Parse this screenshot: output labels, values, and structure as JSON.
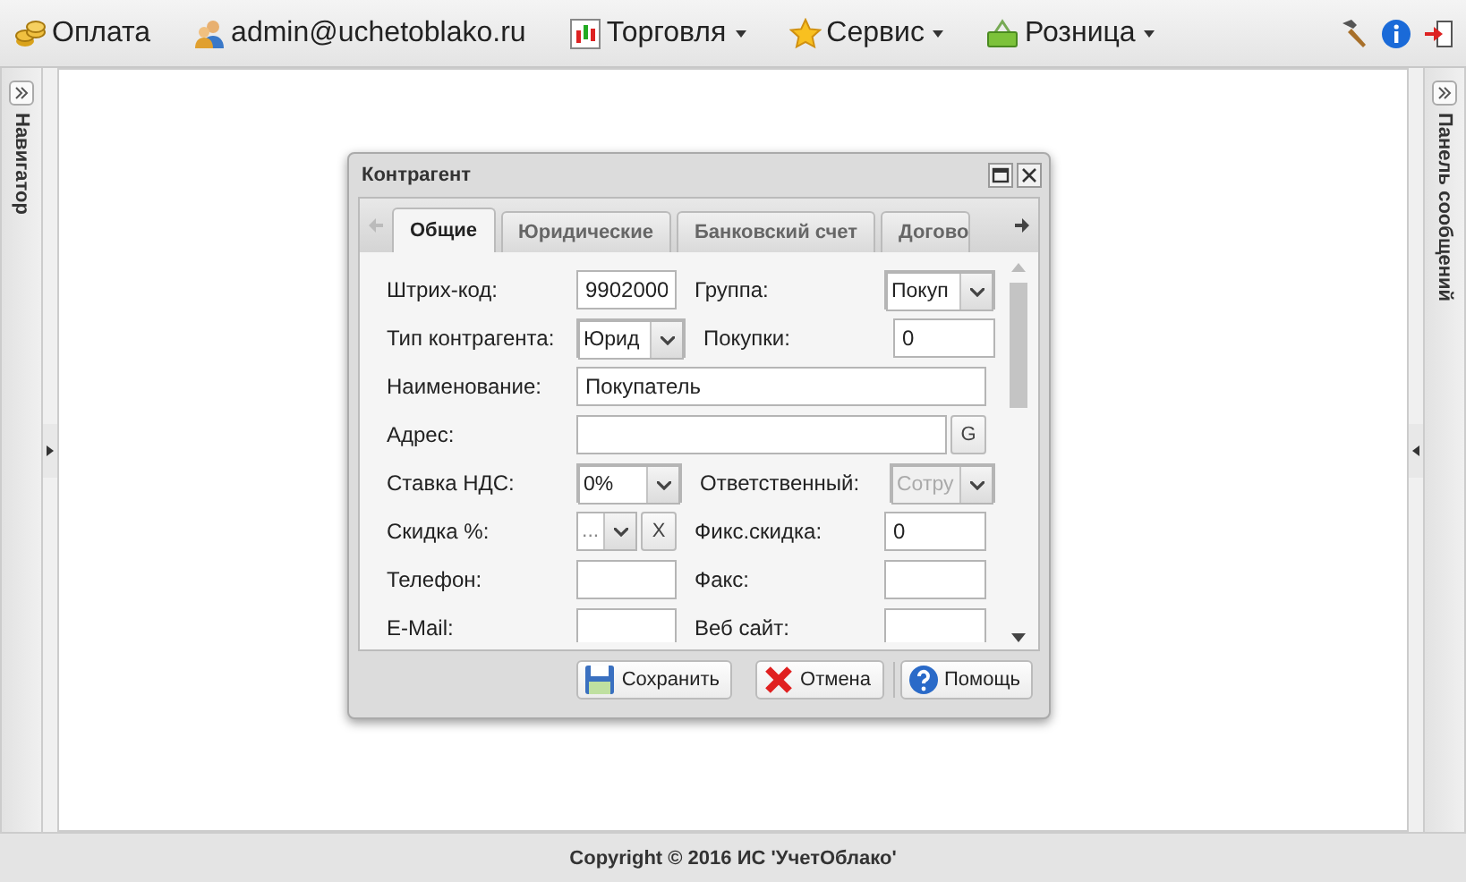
{
  "menu": [
    {
      "kind": "coins",
      "label": "Оплата",
      "dropdown": false
    },
    {
      "kind": "users",
      "label": "admin@uchetoblako.ru",
      "dropdown": false
    },
    {
      "kind": "chart",
      "label": "Торговля",
      "dropdown": true
    },
    {
      "kind": "star",
      "label": "Сервис",
      "dropdown": true
    },
    {
      "kind": "basket",
      "label": "Розница",
      "dropdown": true
    }
  ],
  "left_panel": {
    "title": "Навигатор"
  },
  "right_panel": {
    "title": "Панель сообщений"
  },
  "dialog": {
    "title": "Контрагент",
    "tabs": [
      {
        "label": "Общие",
        "selected": true
      },
      {
        "label": "Юридические",
        "selected": false
      },
      {
        "label": "Банковский счет",
        "selected": false
      },
      {
        "label": "Догово",
        "selected": false
      }
    ],
    "rows": [
      {
        "fields": [
          {
            "label": "Штрих-код:",
            "kind": "text",
            "value": "9902000",
            "disabled": false
          },
          {
            "label": "Группа:",
            "kind": "combo",
            "value": "Покуп",
            "disabled": false
          }
        ]
      },
      {
        "fields": [
          {
            "label": "Тип контрагента:",
            "kind": "combo",
            "value": "Юрид",
            "disabled": false
          },
          {
            "label": "Покупки:",
            "kind": "text",
            "value": "0",
            "disabled": false
          }
        ]
      },
      {
        "fields": [
          {
            "label": "Наименование:",
            "kind": "wide",
            "value": "Покупатель",
            "disabled": false
          }
        ]
      },
      {
        "fields": [
          {
            "label": "Адрес:",
            "kind": "wide-button",
            "button": "G",
            "disabled": false
          }
        ]
      },
      {
        "fields": [
          {
            "label": "Ставка НДС:",
            "kind": "combo",
            "value": "0%",
            "disabled": false
          },
          {
            "label": "Ответственный:",
            "kind": "combo",
            "value": "Сотру",
            "disabled": true
          }
        ]
      },
      {
        "fields": [
          {
            "label": "Скидка %:",
            "kind": "combo-clear",
            "placeholder": "...",
            "button": "X",
            "disabled": false
          },
          {
            "label": "Фикс.скидка:",
            "kind": "text",
            "value": "0",
            "disabled": false
          }
        ]
      },
      {
        "fields": [
          {
            "label": "Телефон:",
            "kind": "text",
            "disabled": false
          },
          {
            "label": "Факс:",
            "kind": "text",
            "disabled": false
          }
        ]
      },
      {
        "fields": [
          {
            "label": "E-Mail:",
            "kind": "text",
            "disabled": false
          },
          {
            "label": "Веб сайт:",
            "kind": "text",
            "disabled": false
          }
        ]
      }
    ],
    "buttons": [
      {
        "kind": "save",
        "label": "Сохранить"
      },
      {
        "kind": "cancel",
        "label": "Отмена"
      },
      {
        "kind": "help",
        "label": "Помощь"
      }
    ]
  },
  "footer": "Copyright © 2016 ИС 'УчетОблако'"
}
